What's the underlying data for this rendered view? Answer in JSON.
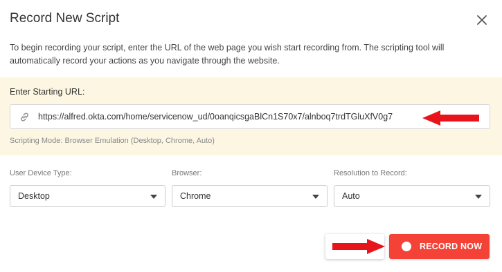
{
  "dialog": {
    "title": "Record New Script",
    "intro": "To begin recording your script, enter the URL of the web page you wish start recording from. The scripting tool will automatically record your actions as you navigate through the website."
  },
  "url_section": {
    "label": "Enter Starting URL:",
    "value": "https://alfred.okta.com/home/servicenow_ud/0oanqicsgaBlCn1S70x7/alnboq7trdTGluXfV0g7",
    "mode_text": "Scripting Mode: Browser Emulation (Desktop, Chrome, Auto)"
  },
  "options": {
    "device": {
      "label": "User Device Type:",
      "value": "Desktop"
    },
    "browser": {
      "label": "Browser:",
      "value": "Chrome"
    },
    "resolution": {
      "label": "Resolution to Record:",
      "value": "Auto"
    }
  },
  "actions": {
    "record_label": "RECORD NOW"
  },
  "colors": {
    "accent_red": "#f44336",
    "annotation_arrow": "#e8141b",
    "url_panel_bg": "#fdf6e3"
  },
  "icons": {
    "close": "close-icon",
    "link": "link-icon",
    "record": "record-dot-icon",
    "dropdown": "chevron-down-icon"
  }
}
